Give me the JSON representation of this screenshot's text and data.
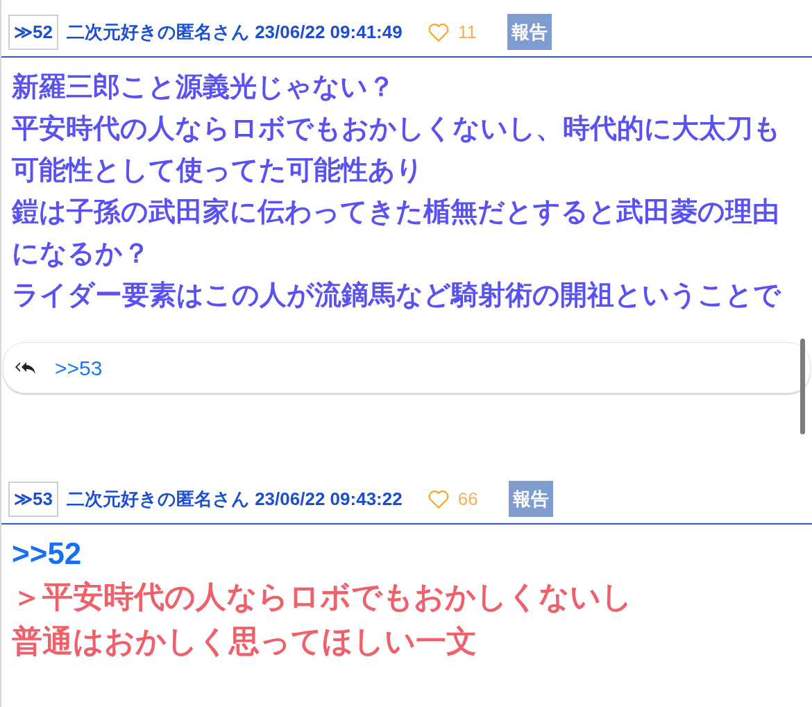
{
  "posts": [
    {
      "number": "≫52",
      "name": "二次元好きの匿名さん",
      "date": "23/06/22 09:41:49",
      "likes": "11",
      "report": "報告",
      "lines": [
        {
          "kind": "text",
          "text": "新羅三郎こと源義光じゃない？"
        },
        {
          "kind": "text",
          "text": "平安時代の人ならロボでもおかしくないし、時代的に大太刀も"
        },
        {
          "kind": "text",
          "text": "可能性として使ってた可能性あり"
        },
        {
          "kind": "text",
          "text": "鎧は子孫の武田家に伝わってきた楯無だとすると武田菱の理由"
        },
        {
          "kind": "text",
          "text": "になるか？"
        },
        {
          "kind": "text",
          "text": "ライダー要素はこの人が流鏑馬など騎射術の開祖ということで"
        }
      ],
      "replies": [
        ">>53"
      ]
    },
    {
      "number": "≫53",
      "name": "二次元好きの匿名さん",
      "date": "23/06/22 09:43:22",
      "likes": "66",
      "report": "報告",
      "lines": [
        {
          "kind": "anchor",
          "text": ">>52"
        },
        {
          "kind": "quote",
          "text": "＞平安時代の人ならロボでもおかしくないし"
        },
        {
          "kind": "quote",
          "text": "普通はおかしく思ってほしい一文"
        }
      ]
    }
  ]
}
